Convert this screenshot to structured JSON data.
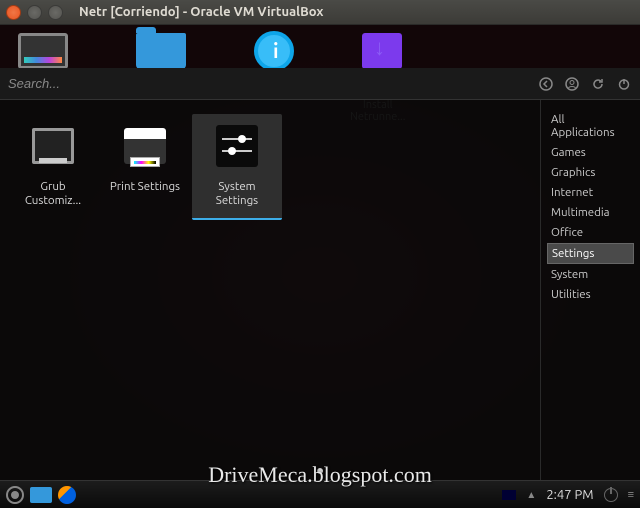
{
  "window": {
    "title": "Netr [Corriendo] - Oracle VM VirtualBox"
  },
  "search": {
    "placeholder": "Search..."
  },
  "toolbar_icons": [
    "back-icon",
    "user-icon",
    "refresh-icon",
    "power-icon"
  ],
  "ghost": {
    "install_l1": "Install",
    "install_l2": "Netrunne..."
  },
  "apps": [
    {
      "id": "grub",
      "label": "Grub Customiz...",
      "selected": false
    },
    {
      "id": "print",
      "label": "Print Settings",
      "selected": false
    },
    {
      "id": "system",
      "label": "System Settings",
      "selected": true
    }
  ],
  "categories": [
    {
      "label": "All Applications",
      "active": false
    },
    {
      "label": "Games",
      "active": false
    },
    {
      "label": "Graphics",
      "active": false
    },
    {
      "label": "Internet",
      "active": false
    },
    {
      "label": "Multimedia",
      "active": false
    },
    {
      "label": "Office",
      "active": false
    },
    {
      "label": "Settings",
      "active": true
    },
    {
      "label": "System",
      "active": false
    },
    {
      "label": "Utilities",
      "active": false
    }
  ],
  "taskbar": {
    "clock": "2:47 PM"
  },
  "watermark": "DriveMeca.blogspot.com"
}
